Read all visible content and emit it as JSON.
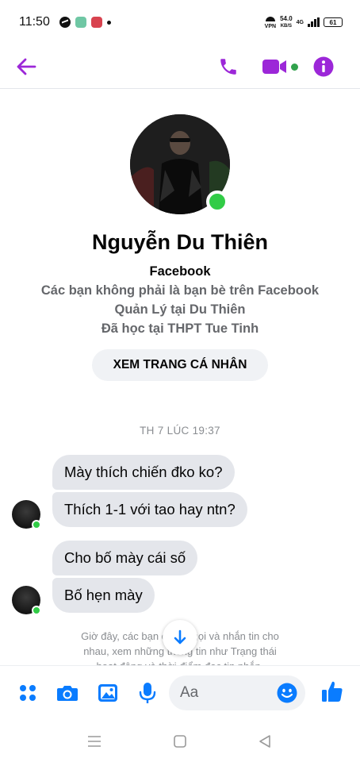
{
  "status_bar": {
    "time": "11:50",
    "vpn_label": "VPN",
    "speed_value": "54.0",
    "speed_unit": "KB/S",
    "network": "4G",
    "battery": "61"
  },
  "header": {
    "accent_color": "#9c27d8"
  },
  "profile": {
    "name": "Nguyễn Du Thiên",
    "platform": "Facebook",
    "relationship": "Các bạn không phải là bạn bè trên Facebook",
    "work": "Quản Lý tại Du Thiên",
    "education": "Đã học tại THPT Tue Tinh",
    "view_profile_label": "XEM TRANG CÁ NHÂN"
  },
  "conversation": {
    "timestamp": "TH 7 LÚC 19:37",
    "messages": [
      {
        "text": "Mày thích chiến đko ko?"
      },
      {
        "text": "Thích 1-1 với tao hay ntn?"
      },
      {
        "text": "Cho bố mày cái số"
      },
      {
        "text": "Bố hẹn mày"
      }
    ],
    "notice_line1": "Giờ đây, các bạn có thể gọi và nhắn tin cho",
    "notice_line2": "nhau, xem những thông tin như Trạng thái",
    "notice_line3": "hoạt động và thời điểm đọc tin nhắn."
  },
  "composer": {
    "placeholder": "Aa",
    "icon_color": "#0a7cff"
  },
  "colors": {
    "online": "#31cc46",
    "bubble": "#e4e6eb"
  }
}
